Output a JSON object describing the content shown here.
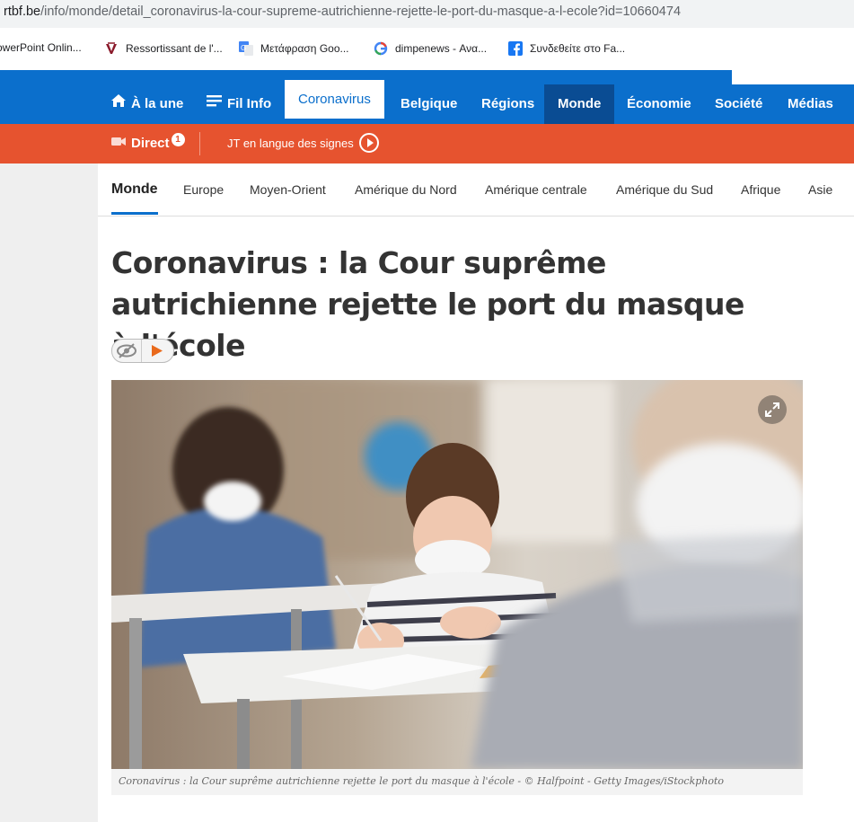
{
  "browser": {
    "url_host": "rtbf.be",
    "url_path": "/info/monde/detail_coronavirus-la-cour-supreme-autrichienne-rejette-le-port-du-masque-a-l-ecole?id=10660474",
    "bookmarks": [
      {
        "label": "owerPoint Onlin...",
        "icon": "powerpoint-icon"
      },
      {
        "label": "Ressortissant de l'...",
        "icon": "university-icon"
      },
      {
        "label": "Μετάφραση Goo...",
        "icon": "google-translate-icon"
      },
      {
        "label": "dimpenews - Ανα...",
        "icon": "google-icon"
      },
      {
        "label": "Συνδεθείτε στο Fa...",
        "icon": "facebook-icon"
      }
    ]
  },
  "nav": {
    "items": [
      {
        "label": "À la une",
        "icon": "home-icon"
      },
      {
        "label": "Fil Info",
        "icon": "list-icon"
      },
      {
        "label": "Coronavirus"
      },
      {
        "label": "Belgique"
      },
      {
        "label": "Régions"
      },
      {
        "label": "Monde"
      },
      {
        "label": "Économie"
      },
      {
        "label": "Société"
      },
      {
        "label": "Médias"
      }
    ],
    "active": "Coronavirus",
    "highlighted": "Monde",
    "color": "#0b6fcc"
  },
  "live": {
    "direct_label": "Direct",
    "direct_badge": "1",
    "jt_label": "JT en langue des signes",
    "color": "#e6532f"
  },
  "subnav": {
    "items": [
      "Monde",
      "Europe",
      "Moyen-Orient",
      "Amérique du Nord",
      "Amérique centrale",
      "Amérique du Sud",
      "Afrique",
      "Asie"
    ],
    "active": "Monde"
  },
  "article": {
    "title": "Coronavirus : la Cour suprême autrichienne rejette le port du masque à l'école",
    "caption": "Coronavirus : la Cour suprême autrichienne rejette le port du masque à l'école - © Halfpoint - Getty Images/iStockphoto"
  }
}
